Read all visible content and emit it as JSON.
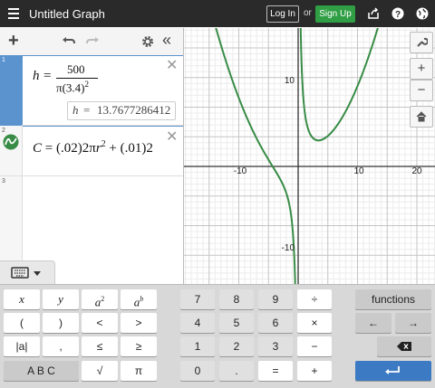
{
  "header": {
    "title": "Untitled Graph",
    "login_label": "Log In",
    "or_label": "or",
    "signup_label": "Sign Up",
    "icons": [
      "menu-icon",
      "share-icon",
      "help-icon",
      "globe-icon"
    ]
  },
  "toolbar": {
    "icons": [
      "add-icon",
      "undo-icon",
      "redo-icon",
      "settings-icon",
      "collapse-icon"
    ]
  },
  "expressions": [
    {
      "index": "1",
      "lhs": "h",
      "numerator": "500",
      "denominator_pi": "π",
      "denominator_base": "(3.4)",
      "denominator_exp": "2",
      "evaluation_label": "h",
      "evaluation_value": "13.7677286412"
    },
    {
      "index": "2",
      "text_c": "C",
      "text_eq": "=",
      "text_p1": "(.02)2π",
      "text_r1": "r",
      "text_exp": "2",
      "text_plus": "+",
      "text_p2": "(.01)2"
    },
    {
      "index": "3"
    }
  ],
  "graph": {
    "x_ticks": [
      "-10",
      "10",
      "20"
    ],
    "y_ticks": [
      "10",
      "-10"
    ],
    "controls": [
      "wrench-icon",
      "zoom-in-icon",
      "zoom-out-icon",
      "home-icon"
    ]
  },
  "keypad": {
    "left": [
      [
        "x",
        "y",
        "a",
        "2",
        "a",
        "b"
      ],
      [
        "(",
        ")",
        "<",
        ">"
      ],
      [
        "|a|",
        ",",
        "≤",
        "≥"
      ],
      [
        "A B C",
        "√",
        "π"
      ]
    ],
    "numbers": [
      [
        "7",
        "8",
        "9",
        "÷"
      ],
      [
        "4",
        "5",
        "6",
        "×"
      ],
      [
        "1",
        "2",
        "3",
        "−"
      ],
      [
        "0",
        ".",
        "=",
        "+"
      ]
    ],
    "functions_label": "functions",
    "arrows": [
      "←",
      "→"
    ]
  },
  "colors": {
    "header_bg": "#2a2a2a",
    "signup_green": "#2f9e44",
    "row1_accent": "#5b93cf",
    "curve_green": "#388c46",
    "enter_blue": "#3c7bc4"
  }
}
